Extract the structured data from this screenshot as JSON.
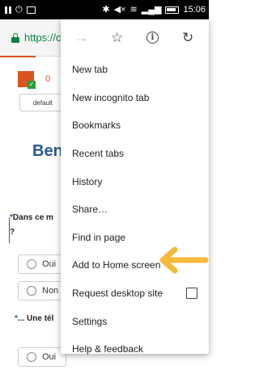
{
  "status_bar": {
    "time": "15:06"
  },
  "url_bar": {
    "url": "https://c"
  },
  "page": {
    "badge_count": "0",
    "chip_label": "default",
    "heading": "Ben",
    "question_1_star": "*",
    "question_1": "Dans ce m",
    "question_1_cont": "?",
    "question_2_star": "*",
    "question_2": "... Une tél",
    "options": {
      "oui_1": "Oui",
      "non_1": "Non",
      "oui_2": "Oui"
    }
  },
  "menu": {
    "toolbar": {
      "forward_icon": "forward-arrow-icon",
      "bookmark_icon": "star-icon",
      "info_icon": "info-icon",
      "reload_icon": "reload-icon"
    },
    "items": [
      {
        "label": "New tab"
      },
      {
        "label": "New incognito tab"
      },
      {
        "label": "Bookmarks"
      },
      {
        "label": "Recent tabs"
      },
      {
        "label": "History"
      },
      {
        "label": "Share…"
      },
      {
        "label": "Find in page"
      },
      {
        "label": "Add to Home screen"
      },
      {
        "label": "Request desktop site"
      },
      {
        "label": "Settings"
      },
      {
        "label": "Help & feedback"
      }
    ]
  },
  "colors": {
    "accent_green": "#0b8043",
    "arrow_yellow": "#f6b93b",
    "heading_blue": "#2a5a8c",
    "brand_orange": "#d9541e"
  }
}
